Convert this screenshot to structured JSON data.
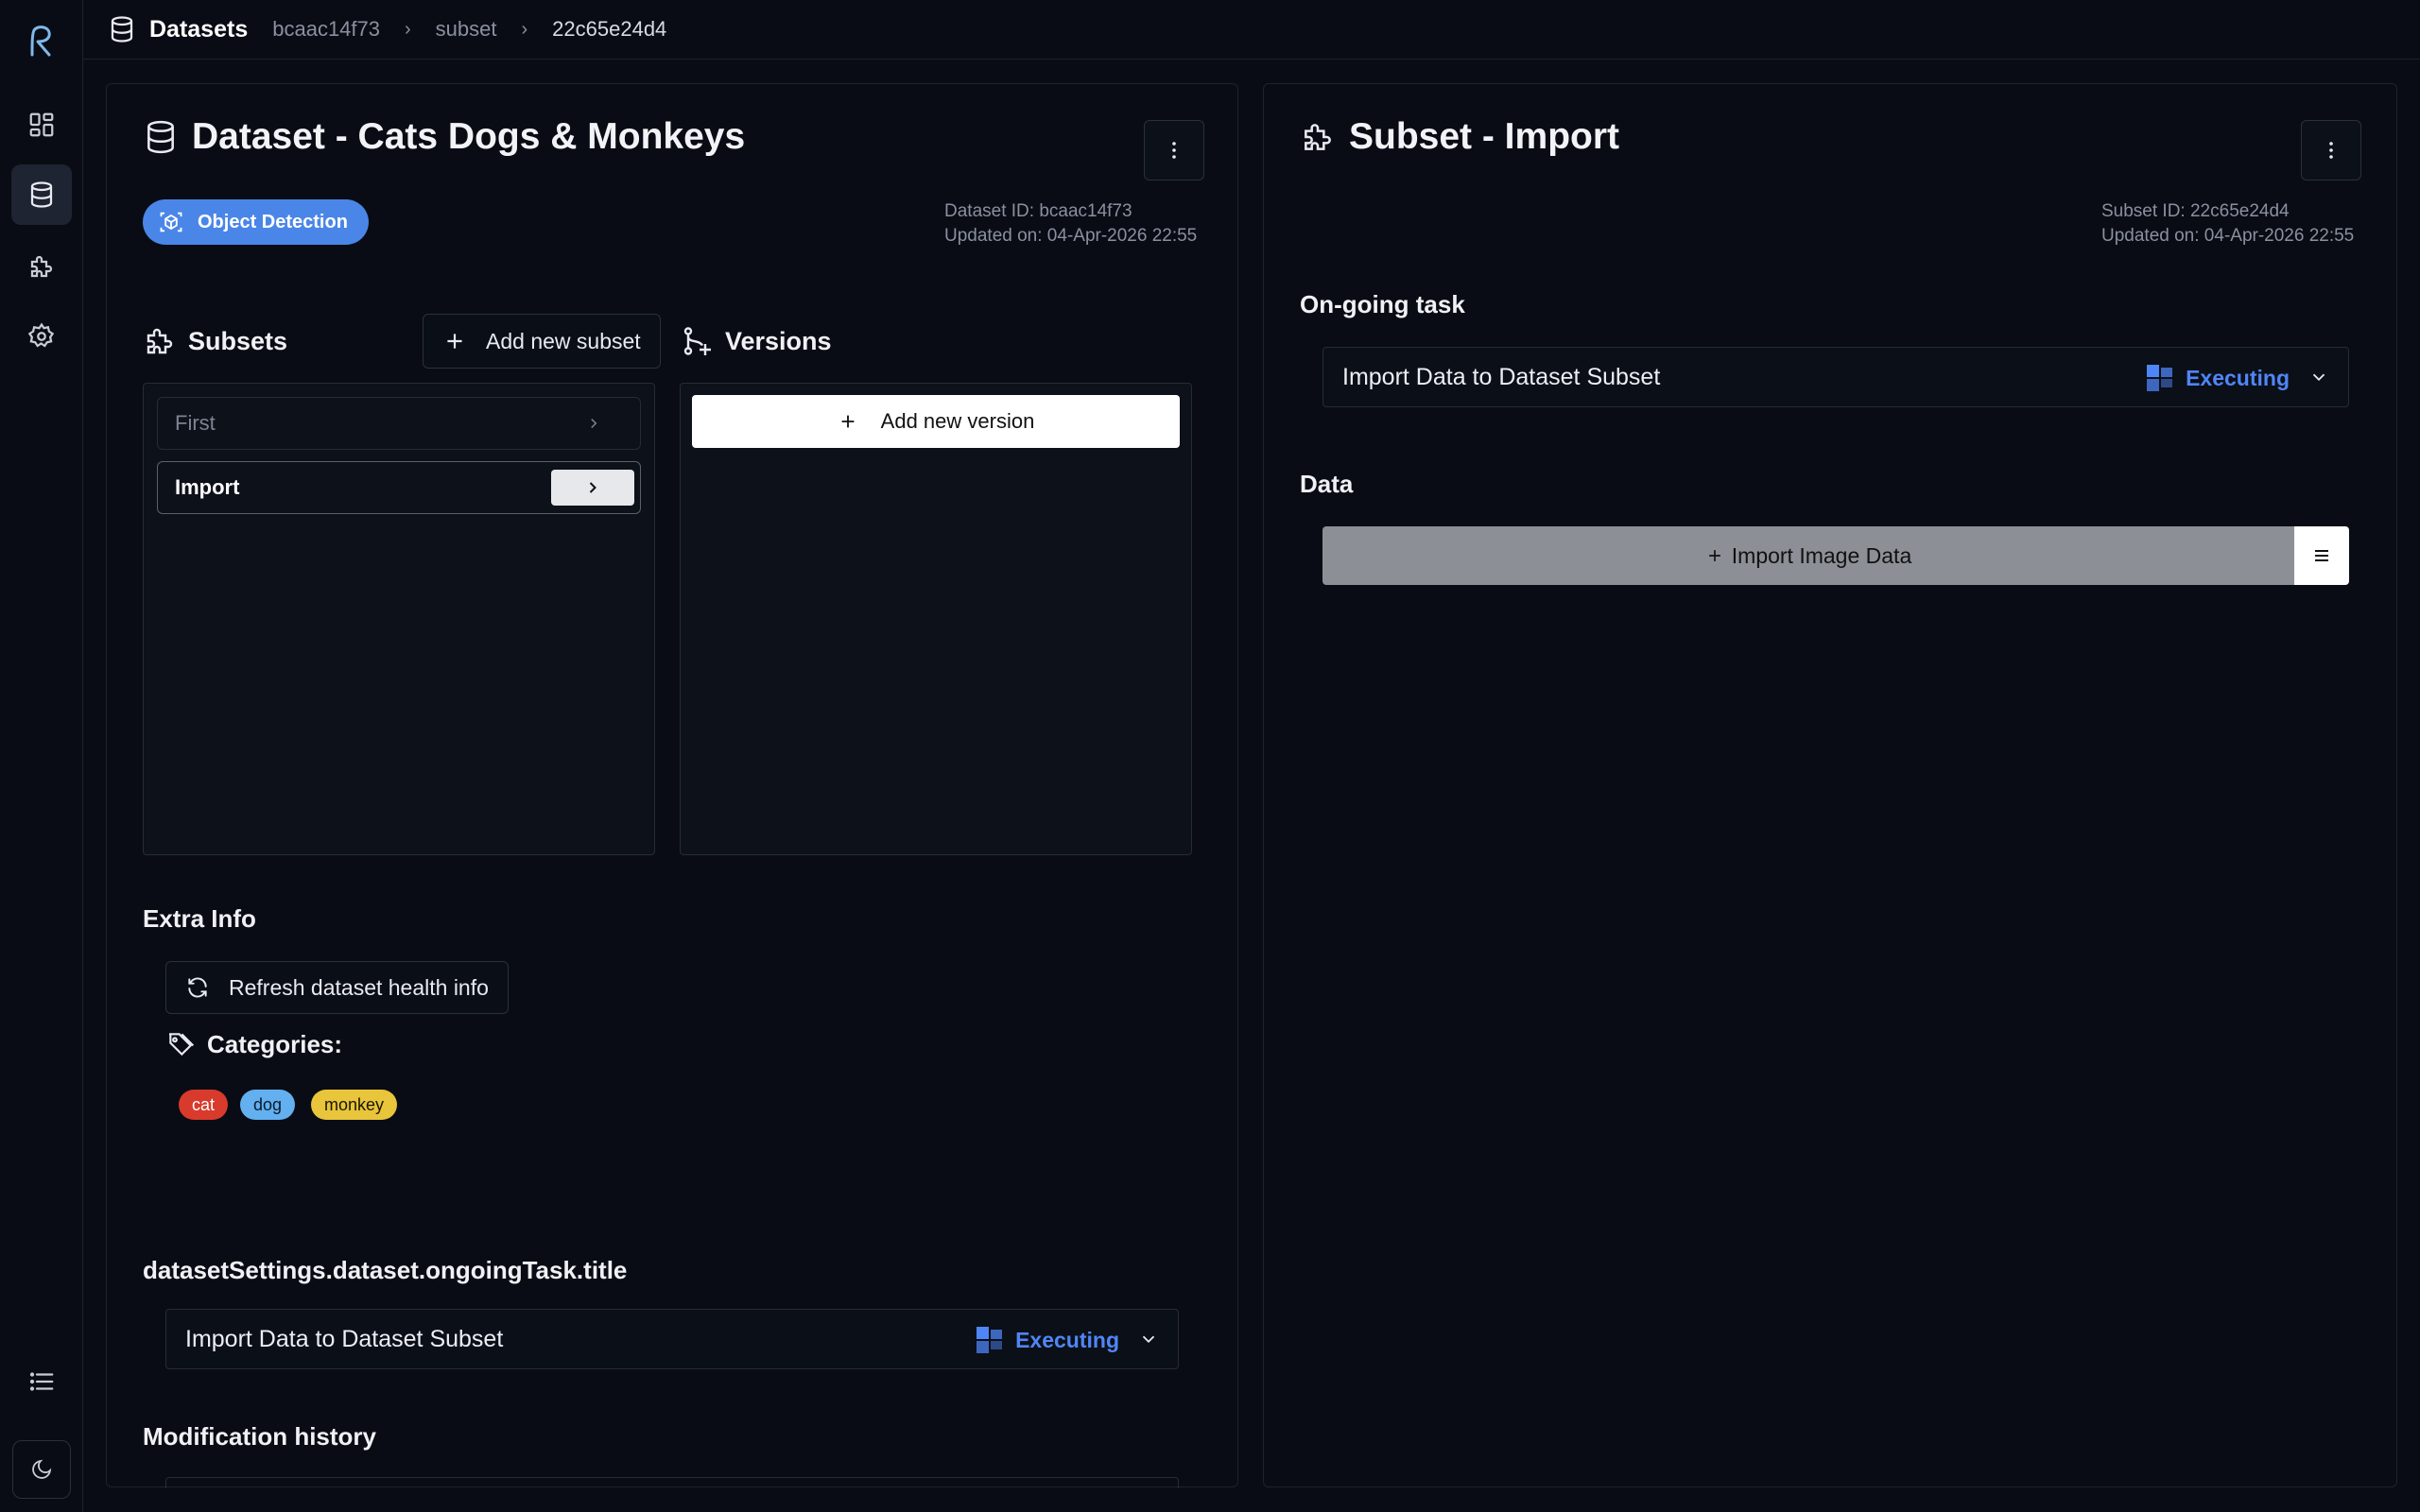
{
  "breadcrumb": {
    "root": "Datasets",
    "items": [
      "bcaac14f73",
      "subset",
      "22c65e24d4"
    ]
  },
  "dataset": {
    "title": "Dataset - Cats Dogs & Monkeys",
    "type_badge": "Object Detection",
    "id_line": "Dataset ID: bcaac14f73",
    "updated_line": "Updated on: 04-Apr-2026 22:55",
    "subsets_heading": "Subsets",
    "add_subset_label": "Add new subset",
    "subsets": [
      {
        "label": "First",
        "selected": false
      },
      {
        "label": "Import",
        "selected": true
      }
    ],
    "versions_heading": "Versions",
    "add_version_label": "Add new version",
    "extra_info_heading": "Extra Info",
    "refresh_label": "Refresh dataset health info",
    "categories_label": "Categories:",
    "categories": [
      {
        "name": "cat",
        "color": "#d83a2c",
        "text": "#ffffff"
      },
      {
        "name": "dog",
        "color": "#62b0f0",
        "text": "#0b1a2a"
      },
      {
        "name": "monkey",
        "color": "#e8c53a",
        "text": "#1a1500"
      }
    ],
    "ongoing_heading": "datasetSettings.dataset.ongoingTask.title",
    "task_name": "Import Data to Dataset Subset",
    "task_status": "Executing",
    "history_heading": "Modification history"
  },
  "subset": {
    "title": "Subset - Import",
    "id_line": "Subset ID: 22c65e24d4",
    "updated_line": "Updated on: 04-Apr-2026 22:55",
    "ongoing_heading": "On-going task",
    "task_name": "Import Data to Dataset Subset",
    "task_status": "Executing",
    "data_heading": "Data",
    "import_label": "Import Image Data"
  },
  "colors": {
    "accent": "#4a86e8",
    "status": "#4f86f7",
    "bg": "#090c14"
  }
}
